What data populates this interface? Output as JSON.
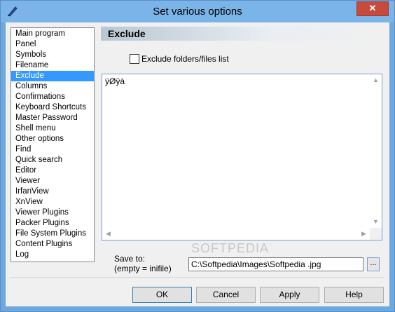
{
  "window": {
    "title": "Set various options",
    "close_glyph": "✕"
  },
  "nav": {
    "items": [
      "Main program",
      "Panel",
      "Symbols",
      "Filename",
      "Exclude",
      "Columns",
      "Confirmations",
      "Keyboard Shortcuts",
      "Master Password",
      "Shell menu",
      "Other options",
      "Find",
      "Quick search",
      "Editor",
      "Viewer",
      "IrfanView",
      "XnView",
      "Viewer Plugins",
      "Packer Plugins",
      "File System Plugins",
      "Content Plugins",
      "Log"
    ],
    "selected_index": 4
  },
  "page": {
    "header": "Exclude",
    "checkbox_label": "Exclude folders/files list",
    "checkbox_checked": false,
    "textarea_value": "ÿØÿà"
  },
  "save": {
    "label_line1": "Save to:",
    "label_line2": "(empty = inifile)",
    "path_value": "C:\\Softpedia\\Images\\Softpedia .jpg",
    "browse_label": "..."
  },
  "buttons": {
    "ok": "OK",
    "cancel": "Cancel",
    "apply": "Apply",
    "help": "Help"
  },
  "icons": [
    "pen-icon",
    "close-icon",
    "scroll-up-icon",
    "scroll-down-icon",
    "scroll-left-icon",
    "scroll-right-icon"
  ]
}
